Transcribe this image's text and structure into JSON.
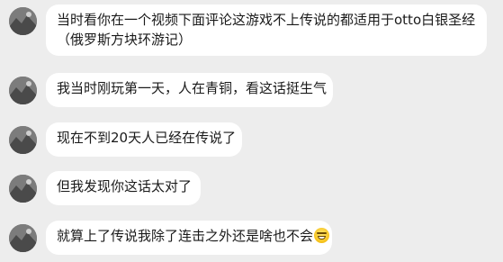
{
  "messages": [
    {
      "lines": [
        "当时看你在一个视频下面评论这游戏不上传说的都适用于otto白银圣经",
        "（俄罗斯方块环游记）"
      ],
      "emoji": ""
    },
    {
      "lines": [
        "我当时刚玩第一天，人在青铜，看这话挺生气"
      ],
      "emoji": ""
    },
    {
      "lines": [
        "现在不到20天人已经在传说了"
      ],
      "emoji": ""
    },
    {
      "lines": [
        "但我发现你这话太对了"
      ],
      "emoji": ""
    },
    {
      "lines": [
        "就算上了传说我除了连击之外还是啥也不会"
      ],
      "emoji": "grinning-sweat-emoji"
    }
  ]
}
